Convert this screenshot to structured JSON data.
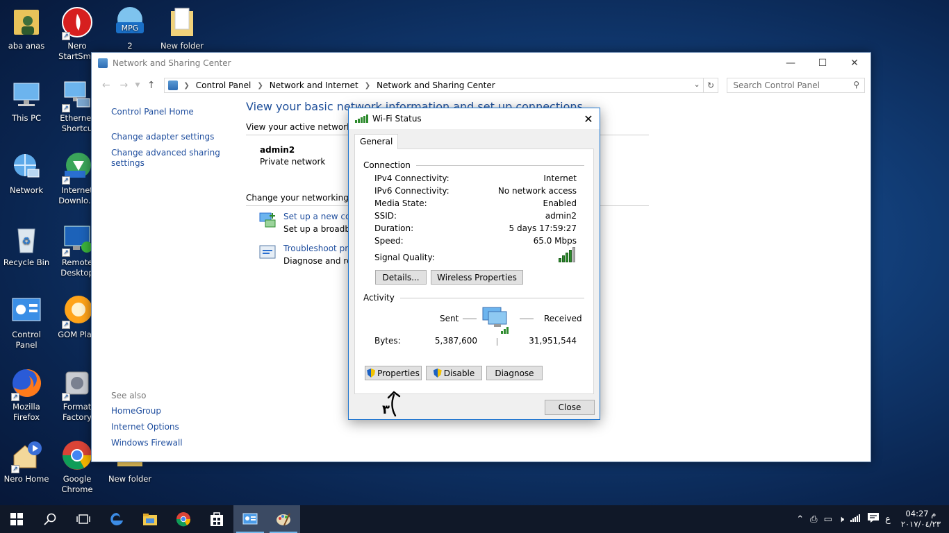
{
  "desktop": {
    "icons": [
      {
        "label": "aba anas",
        "icon": "user-folder-icon"
      },
      {
        "label": "Nero StartSma",
        "icon": "nero-icon"
      },
      {
        "label": "2",
        "icon": "mpg-file-icon",
        "badge": "MPG"
      },
      {
        "label": "New folder",
        "icon": "folder-icon"
      },
      {
        "label": "This PC",
        "icon": "computer-icon"
      },
      {
        "label": "Ethernet Shortcu",
        "icon": "ethernet-icon"
      },
      {
        "label": "Network",
        "icon": "network-globe-icon"
      },
      {
        "label": "Internet Downlo...",
        "icon": "download-manager-icon"
      },
      {
        "label": "Recycle Bin",
        "icon": "recycle-bin-icon"
      },
      {
        "label": "Remote Desktop",
        "icon": "remote-desktop-icon"
      },
      {
        "label": "Control Panel",
        "icon": "control-panel-icon"
      },
      {
        "label": "GOM Play",
        "icon": "gom-player-icon"
      },
      {
        "label": "Mozilla Firefox",
        "icon": "firefox-icon"
      },
      {
        "label": "Format Factory",
        "icon": "format-factory-icon"
      },
      {
        "label": "Nero Home",
        "icon": "nero-home-icon"
      },
      {
        "label": "Google Chrome",
        "icon": "chrome-icon"
      },
      {
        "label": "New folder",
        "icon": "folder-icon"
      }
    ]
  },
  "explorer": {
    "title": "Network and Sharing Center",
    "breadcrumb": [
      "Control Panel",
      "Network and Internet",
      "Network and Sharing Center"
    ],
    "search_placeholder": "Search Control Panel",
    "left_links": [
      "Control Panel Home",
      "Change adapter settings",
      "Change advanced sharing settings"
    ],
    "see_also_header": "See also",
    "see_also_links": [
      "HomeGroup",
      "Internet Options",
      "Windows Firewall"
    ],
    "heading": "View your basic network information and set up connections",
    "active_networks_header": "View your active networks",
    "network_name": "admin2",
    "network_type": "Private network",
    "change_settings_header": "Change your networking set",
    "tasks": [
      {
        "title": "Set up a new conn",
        "desc": "Set up a broadbar",
        "icon": "new-connection-icon"
      },
      {
        "title": "Troubleshoot prol",
        "desc": "Diagnose and rep",
        "icon": "troubleshoot-icon"
      }
    ]
  },
  "wifi_dialog": {
    "title": "Wi-Fi Status",
    "tab": "General",
    "connection_header": "Connection",
    "fields": [
      {
        "label": "IPv4 Connectivity:",
        "value": "Internet"
      },
      {
        "label": "IPv6 Connectivity:",
        "value": "No network access"
      },
      {
        "label": "Media State:",
        "value": "Enabled"
      },
      {
        "label": "SSID:",
        "value": "admin2"
      },
      {
        "label": "Duration:",
        "value": "5 days 17:59:27"
      },
      {
        "label": "Speed:",
        "value": "65.0 Mbps"
      }
    ],
    "signal_quality_label": "Signal Quality:",
    "signal_bars": 4,
    "signal_bars_total": 5,
    "details_button": "Details...",
    "wireless_properties_button": "Wireless Properties",
    "activity_header": "Activity",
    "sent_label": "Sent",
    "received_label": "Received",
    "bytes_label": "Bytes:",
    "bytes_sent": "5,387,600",
    "bytes_received": "31,951,544",
    "properties_button": "Properties",
    "disable_button": "Disable",
    "diagnose_button": "Diagnose",
    "close_button": "Close",
    "annotation_number": "٣"
  },
  "taskbar": {
    "items": [
      "start-icon",
      "search-icon",
      "task-view-icon",
      "edge-icon",
      "file-explorer-icon",
      "chrome-icon",
      "store-icon",
      "control-panel-icon",
      "paint-icon"
    ],
    "tray_language": "ع",
    "clock_time": "04:27 م",
    "clock_date": "٢٠١٧/٠٤/٢٣"
  },
  "colors": {
    "link": "#1f4e9e",
    "heading": "#1e4f9a",
    "accent": "#1e75d0",
    "taskbar": "#101828"
  }
}
